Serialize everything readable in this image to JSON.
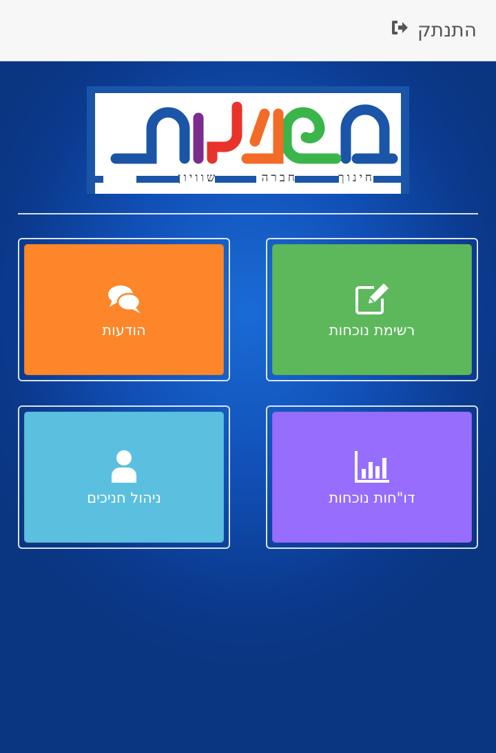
{
  "topbar": {
    "logout_label": "התנתק",
    "logout_icon": "sign-out-icon"
  },
  "logo": {
    "wordmark": "מפעלות",
    "tagline": [
      "חינוך",
      "חברה",
      "שוויון"
    ],
    "colors": [
      "#1a55a8",
      "#3ab54a",
      "#f26c28",
      "#e8322b",
      "#7b2d8e",
      "#1a55a8"
    ]
  },
  "tiles": [
    {
      "id": "attendance-list",
      "label": "רשימת נוכחות",
      "icon": "edit-icon",
      "color": "#5db85c"
    },
    {
      "id": "messages",
      "label": "הודעות",
      "icon": "comments-icon",
      "color": "#fc8629"
    },
    {
      "id": "attendance-reports",
      "label": "דו\"חות נוכחות",
      "icon": "bar-chart-icon",
      "color": "#966dfc"
    },
    {
      "id": "students-management",
      "label": "ניהול חניכים",
      "icon": "user-icon",
      "color": "#5bc0df"
    }
  ]
}
